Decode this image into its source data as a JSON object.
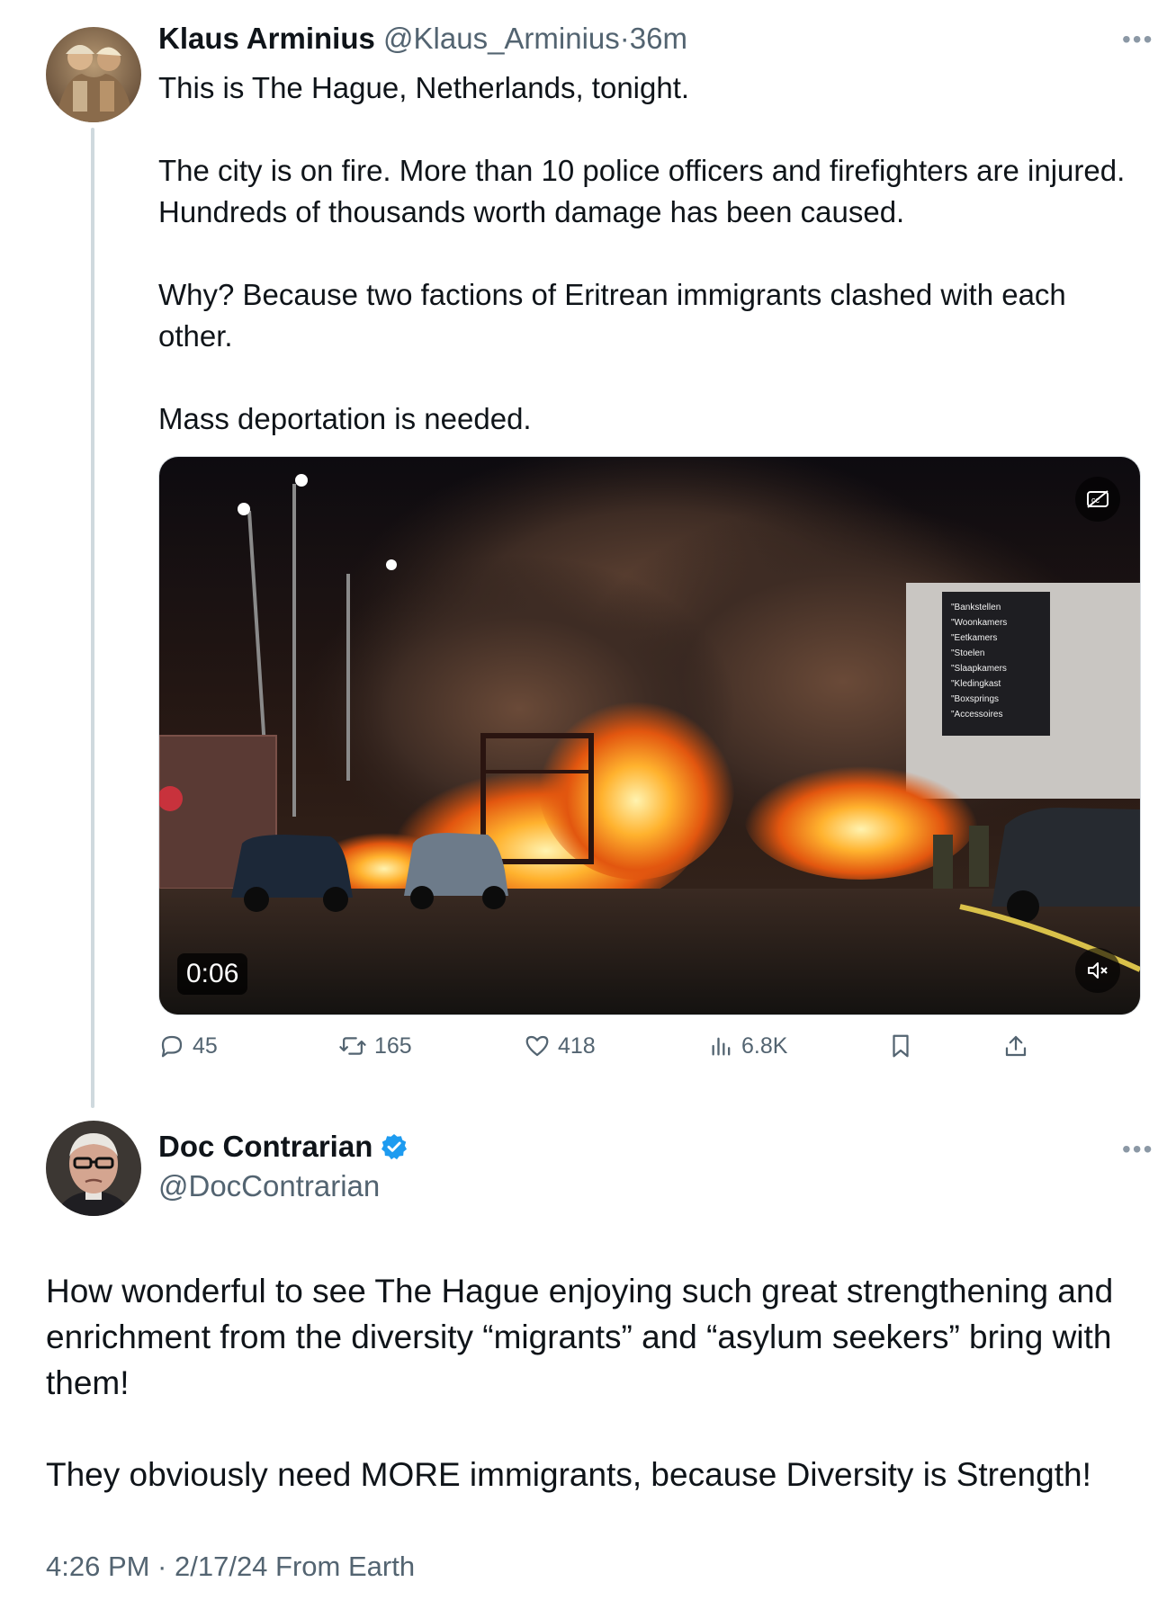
{
  "original_tweet": {
    "author_name": "Klaus Arminius",
    "handle": "@Klaus_Arminius",
    "separator": "·",
    "time_ago": "36m",
    "paragraphs": [
      "This is The Hague, Netherlands, tonight.",
      "The city is on fire. More than 10 police officers and firefighters are injured. Hundreds of thousands worth damage has been caused.",
      "Why? Because two factions of Eritrean immigrants clashed with each other.",
      "Mass deportation is needed."
    ],
    "video": {
      "duration": "0:06",
      "store_sign": [
        "\"Bankstellen",
        "\"Woonkamers",
        "\"Eetkamers",
        "\"Stoelen",
        "\"Slaapkamers",
        "\"Kledingkast",
        "\"Boxsprings",
        "\"Accessoires"
      ]
    },
    "stats": {
      "replies": "45",
      "reposts": "165",
      "likes": "418",
      "views": "6.8K"
    },
    "more_icon": "more-horizontal-icon"
  },
  "reply_tweet": {
    "author_name": "Doc Contrarian",
    "verified": true,
    "verified_color": "#1d9bf0",
    "handle": "@DocContrarian",
    "paragraphs": [
      "How wonderful to see The Hague enjoying such great strengthening and enrichment from the diversity “migrants” and “asylum seekers” bring with them!",
      "They obviously need MORE immigrants, because Diversity is Strength!"
    ],
    "timestamp": "4:26 PM · 2/17/24 From Earth"
  },
  "colors": {
    "text": "#0f1419",
    "muted": "#536471",
    "thread_line": "#cfd9de"
  }
}
